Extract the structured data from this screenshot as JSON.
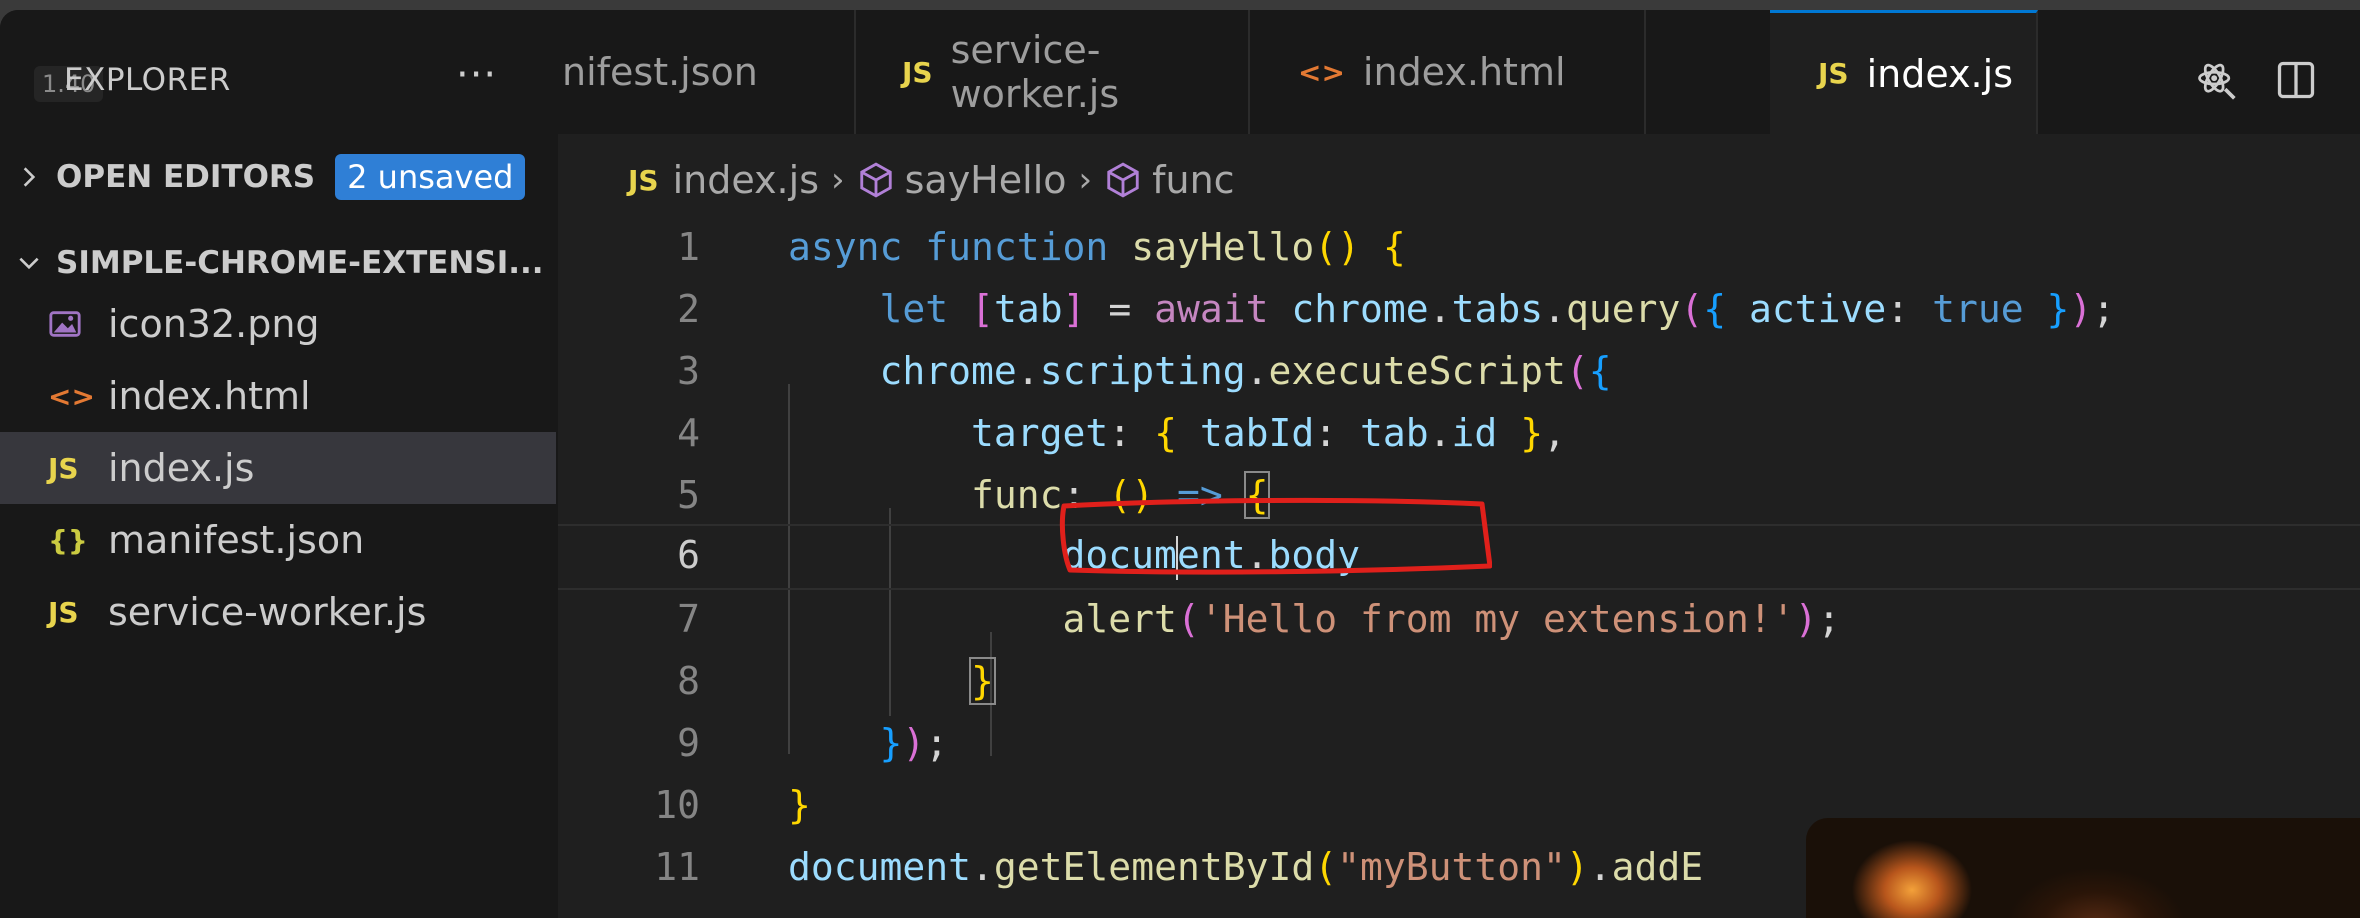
{
  "zoom_badge": "1.40",
  "sidebar": {
    "title": "EXPLORER",
    "more": "···",
    "open_editors": {
      "label": "OPEN EDITORS",
      "badge": "2 unsaved"
    },
    "folder": {
      "label": "SIMPLE-CHROME-EXTENSI..."
    },
    "files": [
      {
        "name": "icon32.png",
        "icon": "image-icon",
        "icon_text": "▣"
      },
      {
        "name": "index.html",
        "icon": "html-icon",
        "icon_text": "<>"
      },
      {
        "name": "index.js",
        "icon": "js-icon",
        "icon_text": "JS",
        "selected": true
      },
      {
        "name": "manifest.json",
        "icon": "json-icon",
        "icon_text": "{}"
      },
      {
        "name": "service-worker.js",
        "icon": "js-icon",
        "icon_text": "JS"
      }
    ]
  },
  "tabs": [
    {
      "name": "nifest.json"
    },
    {
      "name": "service-worker.js",
      "icon_text": "JS"
    },
    {
      "name": "index.html",
      "icon_text": "<>"
    },
    {
      "name": "index.js",
      "icon_text": "JS",
      "active": true,
      "dirty": true
    }
  ],
  "breadcrumb": {
    "icon_text": "JS",
    "file": "index.js",
    "symbol1": "sayHello",
    "symbol2": "func"
  },
  "line_numbers": [
    "1",
    "2",
    "3",
    "4",
    "5",
    "6",
    "7",
    "8",
    "9",
    "10",
    "11"
  ],
  "code": {
    "l1": {
      "async": "async",
      "function": "function",
      "name": "sayHello",
      "paren": "()",
      "brace": "{"
    },
    "l2": {
      "let": "let",
      "lb": "[",
      "tab": "tab",
      "rb": "]",
      "eq": " = ",
      "await": "await",
      "chrome": "chrome",
      "d1": ".",
      "tabs": "tabs",
      "d2": ".",
      "query": "query",
      "lp": "(",
      "lc": "{",
      "active": "active",
      "colon": ": ",
      "true": "true",
      "rc": "}",
      "rp": ")",
      "semi": ";"
    },
    "l3": {
      "chrome": "chrome",
      "d1": ".",
      "scripting": "scripting",
      "d2": ".",
      "exec": "executeScript",
      "lp": "(",
      "lc": "{"
    },
    "l4": {
      "target": "target",
      "colon": ": ",
      "lc": "{",
      "tabId": "tabId",
      "colon2": ": ",
      "tab": "tab",
      "dot": ".",
      "id": "id",
      "rc": "}",
      "comma": ","
    },
    "l5": {
      "func": "func",
      "colon": ": ",
      "parens": "()",
      "arrow": " => ",
      "lc": "{"
    },
    "l6": {
      "document_a": "docum",
      "document_b": "ent",
      "dot": ".",
      "body": "body"
    },
    "l7": {
      "alert": "alert",
      "lp": "(",
      "str": "'Hello from my extension!'",
      "rp": ")",
      "semi": ";"
    },
    "l8": {
      "rc": "}"
    },
    "l9": {
      "rc": "}",
      "rp": ")",
      "semi": ";"
    },
    "l10": {
      "rc": "}"
    },
    "l11": {
      "document": "document",
      "dot": ".",
      "getById": "getElementById",
      "lp": "(",
      "str": "\"myButton\"",
      "rp": ")",
      "dot2": ".",
      "rest": "addE"
    }
  },
  "colors": {
    "accent": "#0078d4",
    "badge": "#2f7fd6",
    "annotation": "#e0201b"
  }
}
